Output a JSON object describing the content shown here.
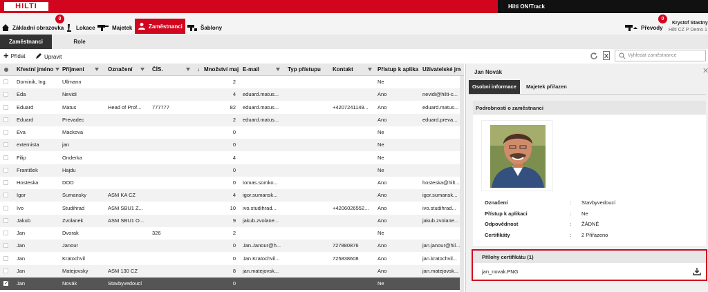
{
  "brand": {
    "logo": "HILTI",
    "product": "Hilti ON!Track"
  },
  "nav": {
    "items": [
      {
        "label": "Základní obrazovka",
        "badge": "0",
        "icon": "home-icon"
      },
      {
        "label": "Lokace",
        "icon": "location-icon"
      },
      {
        "label": "Majetek",
        "icon": "tool-icon"
      },
      {
        "label": "Zaměstnanci",
        "icon": "people-icon",
        "active": true
      },
      {
        "label": "Šablony",
        "icon": "template-icon"
      }
    ],
    "transfers": {
      "label": "Převody",
      "badge": "0",
      "icon": "transfer-icon"
    },
    "user": {
      "name": "Krystof Stastny",
      "org": "Hilti CZ P Demo 1"
    }
  },
  "subtabs": [
    "Zaměstnanci",
    "Role"
  ],
  "toolbar": {
    "add": "Přidat",
    "edit": "Upravit",
    "search_placeholder": "Vyhledat zaměstnance"
  },
  "table": {
    "columns": [
      "Křestní jméno",
      "Příjmení",
      "Označení",
      "ČÍS.",
      "Množství maj",
      "E-mail",
      "Typ přístupu",
      "Kontakt",
      "Přístup k aplika",
      "Uživatelské jmé"
    ],
    "rows": [
      [
        "Dominik, Ing.",
        "Ullmann",
        "",
        "",
        "2",
        "",
        "",
        "",
        "Ne",
        ""
      ],
      [
        "Eda",
        "Nevidi",
        "",
        "",
        "4",
        "eduard.matus...",
        "",
        "",
        "Ano",
        "nevidi@hilti-c..."
      ],
      [
        "Eduard",
        "Matus",
        "Head of Prof...",
        "777777",
        "82",
        "eduard.matus...",
        "",
        "+4207241149...",
        "Ano",
        "eduard.matus..."
      ],
      [
        "Eduard",
        "Prevadec",
        "",
        "",
        "2",
        "eduard.matus...",
        "",
        "",
        "Ano",
        "eduard.preva..."
      ],
      [
        "Eva",
        "Mackova",
        "",
        "",
        "0",
        "",
        "",
        "",
        "Ne",
        ""
      ],
      [
        "externista",
        "jan",
        "",
        "",
        "0",
        "",
        "",
        "",
        "Ne",
        ""
      ],
      [
        "Filip",
        "Onderka",
        "",
        "",
        "4",
        "",
        "",
        "",
        "Ne",
        ""
      ],
      [
        "František",
        "Hajdu",
        "",
        "",
        "0",
        "",
        "",
        "",
        "Ne",
        ""
      ],
      [
        "Hosteska",
        "DOD",
        "",
        "",
        "0",
        "tomas.somko...",
        "",
        "",
        "Ano",
        "hosteska@hilt..."
      ],
      [
        "Igor",
        "Sumansky",
        "ASM KA CZ",
        "",
        "4",
        "igor.sumansk...",
        "",
        "",
        "Ano",
        "igor.sumansk..."
      ],
      [
        "Ivo",
        "Studihrad",
        "ASM SBU1 Z...",
        "",
        "10",
        "ivo.studihrad...",
        "",
        "+4206026552...",
        "Ano",
        "ivo.studihrad..."
      ],
      [
        "Jakub",
        "Zvolanek",
        "ASM SBU1 O...",
        "",
        "9",
        "jakub.zvolane...",
        "",
        "",
        "Ano",
        "jakub.zvolane..."
      ],
      [
        "Jan",
        "Dvorak",
        "",
        "326",
        "2",
        "",
        "",
        "",
        "Ne",
        ""
      ],
      [
        "Jan",
        "Janour",
        "",
        "",
        "0",
        "Jan.Janour@h...",
        "",
        "727880876",
        "Ano",
        "jan.janour@hil..."
      ],
      [
        "Jan",
        "Kratochvil",
        "",
        "",
        "0",
        "Jan.Kratochvil...",
        "",
        "725838608",
        "Ano",
        "jan.kratochvil..."
      ],
      [
        "Jan",
        "Matejovsky",
        "ASM 130 CZ",
        "",
        "8",
        "jan.matejovsk...",
        "",
        "",
        "Ano",
        "jan.matejovsk..."
      ],
      [
        "Jan",
        "Novák",
        "Stavbyvedoucí",
        "",
        "0",
        "",
        "",
        "",
        "Ne",
        ""
      ]
    ]
  },
  "panel": {
    "title": "Jan Novák",
    "tabs": [
      "Osobní informace",
      "Majetek přiřazen"
    ],
    "details_title": "Podrobnosti o zaměstnanci",
    "fields": [
      {
        "k": "Označení",
        "v": "Stavbyvedoucí"
      },
      {
        "k": "Přístup k aplikaci",
        "v": "Ne"
      },
      {
        "k": "Odpovědnost",
        "v": "ŽÁDNÉ"
      },
      {
        "k": "Certifikáty",
        "v": "2 Přiřazeno"
      }
    ],
    "attachments_title": "Přílohy certifikátu (1)",
    "attachment_file": "jan_novak.PNG"
  }
}
